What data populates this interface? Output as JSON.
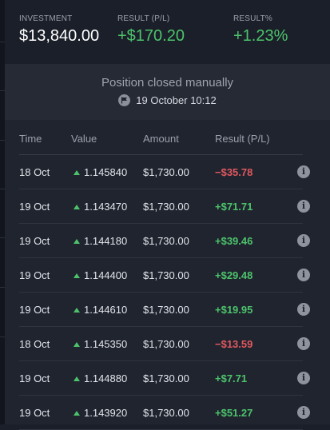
{
  "summary": {
    "investment_label": "INVESTMENT",
    "investment_value": "$13,840.00",
    "result_label": "RESULT (P/L)",
    "result_value": "+$170.20",
    "percent_label": "RESULT%",
    "percent_value": "+1.23%"
  },
  "closed": {
    "title": "Position closed manually",
    "date": "19 October 10:12",
    "icon": "flag-icon"
  },
  "table": {
    "headers": [
      "Time",
      "Value",
      "Amount",
      "Result (P/L)"
    ],
    "rows": [
      {
        "time": "18 Oct",
        "value": "1.145840",
        "amount": "$1,730.00",
        "result": "−$35.78",
        "sign": "neg"
      },
      {
        "time": "19 Oct",
        "value": "1.143470",
        "amount": "$1,730.00",
        "result": "+$71.71",
        "sign": "pos"
      },
      {
        "time": "19 Oct",
        "value": "1.144180",
        "amount": "$1,730.00",
        "result": "+$39.46",
        "sign": "pos"
      },
      {
        "time": "19 Oct",
        "value": "1.144400",
        "amount": "$1,730.00",
        "result": "+$29.48",
        "sign": "pos"
      },
      {
        "time": "19 Oct",
        "value": "1.144610",
        "amount": "$1,730.00",
        "result": "+$19.95",
        "sign": "pos"
      },
      {
        "time": "18 Oct",
        "value": "1.145350",
        "amount": "$1,730.00",
        "result": "−$13.59",
        "sign": "neg"
      },
      {
        "time": "19 Oct",
        "value": "1.144880",
        "amount": "$1,730.00",
        "result": "+$7.71",
        "sign": "pos"
      },
      {
        "time": "19 Oct",
        "value": "1.143920",
        "amount": "$1,730.00",
        "result": "+$51.27",
        "sign": "pos"
      }
    ]
  },
  "colors": {
    "positive": "#4cc36b",
    "negative": "#e0585f",
    "background": "#20242f"
  }
}
